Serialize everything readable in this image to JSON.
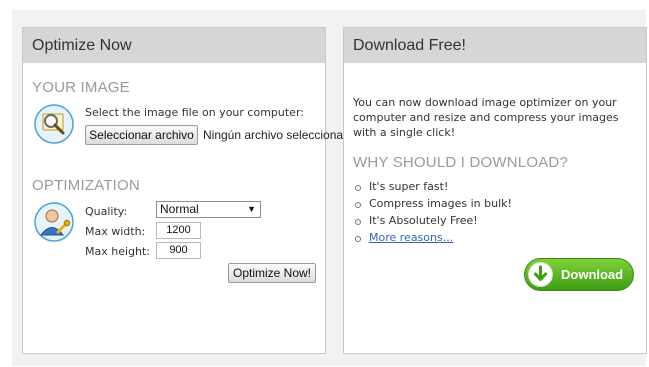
{
  "left_panel": {
    "title": "Optimize Now",
    "image_section": {
      "heading": "YOUR IMAGE",
      "instruction": "Select the image file on your computer:",
      "file_button": "Seleccionar archivo",
      "file_status": "Ningún archivo seleccionado",
      "icon": "magnifier-image-icon"
    },
    "optimization_section": {
      "heading": "OPTIMIZATION",
      "icon": "user-settings-icon",
      "quality_label": "Quality:",
      "quality_value": "Normal",
      "max_width_label": "Max width:",
      "max_width_value": "1200",
      "max_height_label": "Max height:",
      "max_height_value": "900",
      "optimize_button": "Optimize Now!"
    }
  },
  "right_panel": {
    "title": "Download Free!",
    "description": "You can now download image optimizer on your computer and resize and compress your images with a single click!",
    "why_heading": "WHY SHOULD I DOWNLOAD?",
    "reasons": [
      "It's super fast!",
      "Compress images in bulk!",
      "It's Absolutely Free!"
    ],
    "more_link": "More reasons...",
    "download_button": "Download",
    "download_icon": "download-arrow-icon",
    "accent_color": "#4caf1c"
  }
}
